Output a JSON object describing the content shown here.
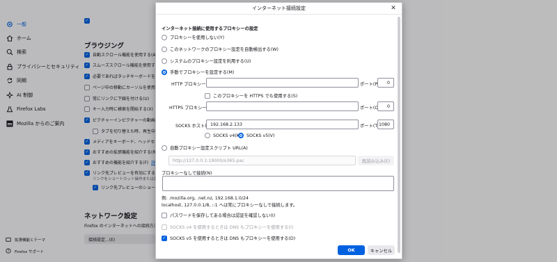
{
  "sidebar": {
    "items": [
      {
        "label": "一般",
        "icon": "gear-icon",
        "active": true
      },
      {
        "label": "ホーム",
        "icon": "home-icon"
      },
      {
        "label": "検索",
        "icon": "search-icon"
      },
      {
        "label": "プライバシーとセキュリティ",
        "icon": "lock-icon"
      },
      {
        "label": "同期",
        "icon": "sync-icon"
      },
      {
        "label": "AI 制御",
        "icon": "ai-icon"
      },
      {
        "label": "Firefox Labs",
        "icon": "flask-icon"
      },
      {
        "label": "Mozilla からのご案内",
        "icon": "mozilla-icon"
      }
    ],
    "footer": [
      {
        "label": "拡張機能とテーマ",
        "icon": "puzzle-icon"
      },
      {
        "label": "Firefox サポート",
        "icon": "help-icon"
      }
    ]
  },
  "browsing": {
    "title": "ブラウジング",
    "options": [
      {
        "label": "自動スクロール機能を使用する(A)",
        "checked": true
      },
      {
        "label": "スムーズスクロール機能を使用する(M)",
        "checked": true
      },
      {
        "label": "必要であればタッチキーボードを表示す",
        "checked": true
      },
      {
        "label": "ページ中の移動にカーソルを使用する",
        "checked": false
      },
      {
        "label": "常にリンクに下線を付ける(U)",
        "checked": false
      },
      {
        "label": "キー入力時に検索を開始する(X)",
        "checked": false
      },
      {
        "label": "ピクチャーインピクチャーの動画の操作",
        "checked": true
      },
      {
        "label": "タブを切り替えた時、再生中の動画",
        "checked": false
      },
      {
        "label": "メディアをキーボード、ヘッドセット、仮",
        "checked": true
      },
      {
        "label": "おすすめの拡張機能を紹介する(R)",
        "checked": true
      },
      {
        "label": "おすすめの機能を紹介する(F)",
        "checked": true
      },
      {
        "label": "リンク先プレビューを有効にする",
        "checked": true
      }
    ],
    "link_preview_note": "リンクをショートカット操作または長押しでプレビュー",
    "link_preview_sub": "リンク先プレビューのショートカット",
    "more_link": "詳細情報"
  },
  "network": {
    "title": "ネットワーク設定",
    "description": "Firefox のインターネットへの接続方法を",
    "settings_button": "接続設定...(E)"
  },
  "dialog": {
    "title": "インターネット接続設定",
    "section_label": "インターネット接続に使用するプロキシーの設定",
    "proxy_options": [
      {
        "label": "プロキシーを使用しない(Y)",
        "selected": false
      },
      {
        "label": "このネットワークのプロキシー設定を自動検出する(W)",
        "selected": false
      },
      {
        "label": "システムのプロキシー設定を利用する(U)",
        "selected": false
      },
      {
        "label": "手動でプロキシーを設定する(M)",
        "selected": true
      }
    ],
    "http_proxy": {
      "label": "HTTP プロキシー(X)",
      "value": "",
      "port_label": "ポート(P)",
      "port": "0"
    },
    "https_same_checkbox": {
      "label": "このプロキシーを HTTPS でも使用する(S)",
      "checked": false
    },
    "https_proxy": {
      "label": "HTTPS プロキシー(H)",
      "value": "",
      "port_label": "ポート(O)",
      "port": "0"
    },
    "socks_host": {
      "label": "SOCKS ホスト(C)",
      "value": "192.168.2.133",
      "port_label": "ポート(T)",
      "port": "1080"
    },
    "socks_versions": [
      {
        "label": "SOCKS v4(K)",
        "selected": false
      },
      {
        "label": "SOCKS v5(V)",
        "selected": true
      }
    ],
    "auto_config": {
      "label": "自動プロキシー設定スクリプト URL(A)",
      "placeholder": "http://127.0.0.1:19000/o365.pac",
      "reload_button": "再読み込み(E)"
    },
    "no_proxy_label": "プロキシーなしで接続(N)",
    "no_proxy_value": "",
    "example_line1": "例: .mozilla.org, .net.nz, 192.168.1.0/24",
    "example_line2": "localhost, 127.0.0.1/8, ::1 へは常にプロキシーなしで接続します。",
    "bottom_options": [
      {
        "label": "パスワードを保存してある場合は認証を確認しない(I)",
        "checked": false,
        "disabled": false
      },
      {
        "label": "SOCKS v4 を使用するときは DNS もプロキシーを使用する(I)",
        "checked": false,
        "disabled": true
      },
      {
        "label": "SOCKS v5 を使用するときは DNS もプロキシーを使用する(D)",
        "checked": true,
        "disabled": false
      }
    ],
    "ok_button": "OK",
    "cancel_button": "キャンセル"
  },
  "colors": {
    "accent": "#0061e0",
    "overlay": "rgba(12,12,13,0.26)"
  }
}
